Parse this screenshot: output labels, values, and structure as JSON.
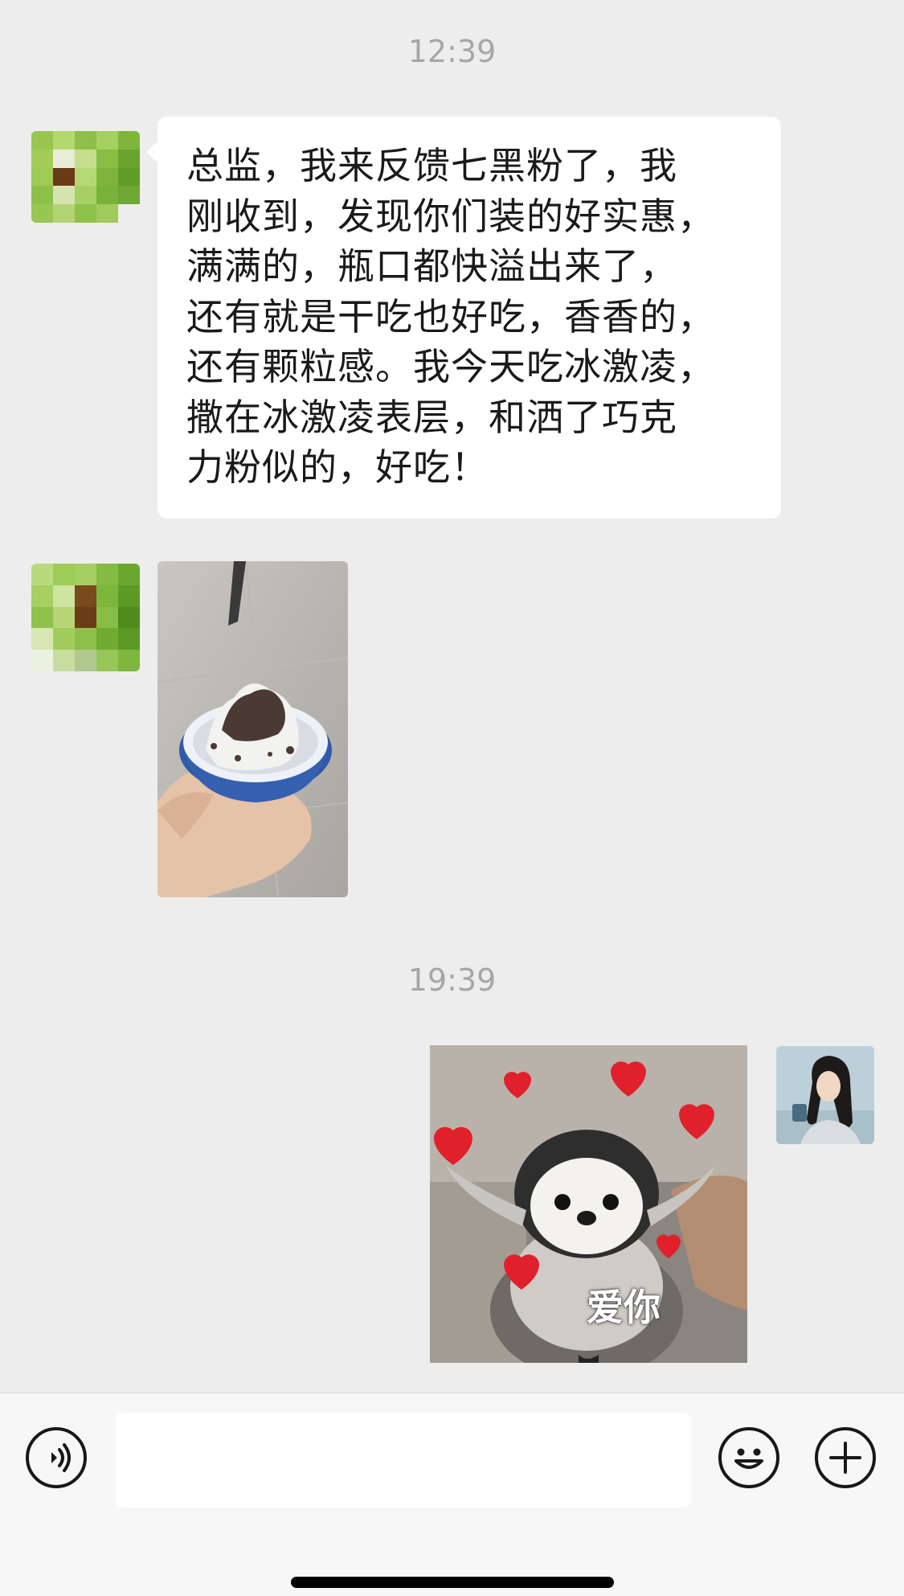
{
  "chat": {
    "timestamp_1": "12:39",
    "timestamp_2": "19:39",
    "messages": [
      {
        "side": "left",
        "type": "text",
        "text": "总监，我来反馈七黑粉了，我\n刚收到，发现你们装的好实惠，\n满满的，瓶口都快溢出来了，\n还有就是干吃也好吃，香香的，\n还有颗粒感。我今天吃冰激凌，\n撒在冰激凌表层，和洒了巧克\n力粉似的，好吃！"
      },
      {
        "side": "left",
        "type": "image",
        "image": "ice-cream-cup-with-black-sesame-powder-photo"
      },
      {
        "side": "right",
        "type": "sticker",
        "image": "penguin-plush-with-hearts-sticker",
        "caption": "爱你"
      }
    ]
  },
  "input_bar": {
    "voice_icon": "voice-icon",
    "emoji_icon": "emoji-icon",
    "plus_icon": "plus-icon",
    "text_value": ""
  },
  "colors": {
    "background": "#ededed",
    "bubble": "#ffffff",
    "timestamp": "#a6a6a6",
    "input_bar": "#f7f7f7"
  }
}
